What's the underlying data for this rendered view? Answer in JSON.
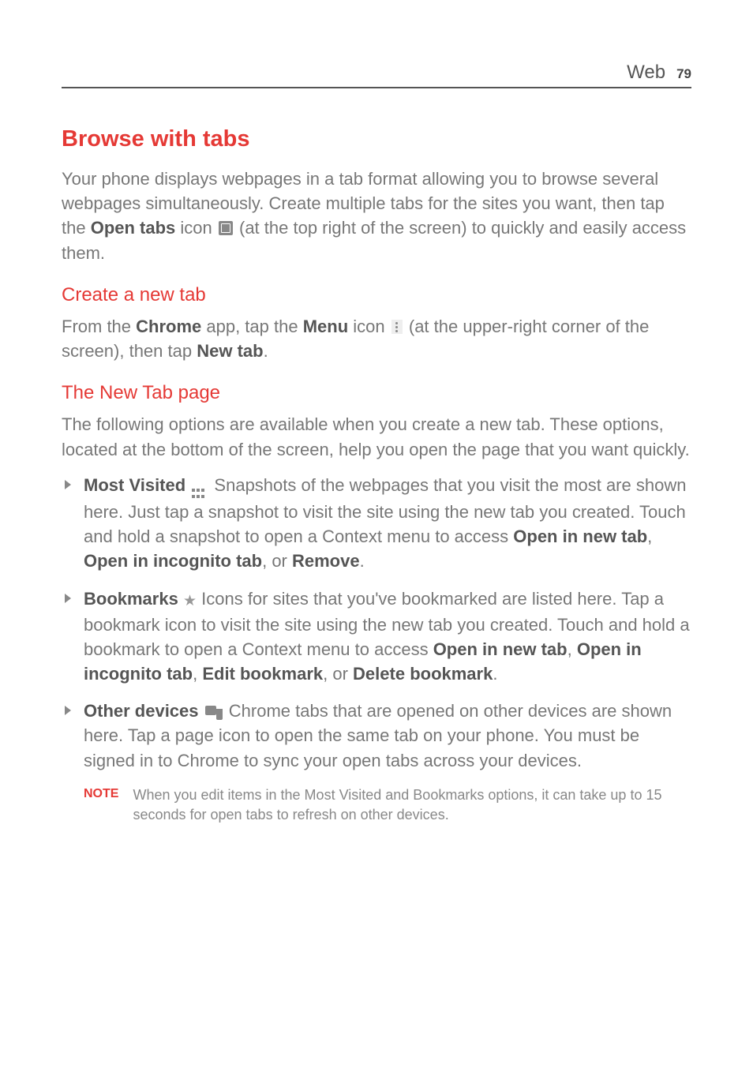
{
  "header": {
    "section": "Web",
    "page": "79"
  },
  "h1": "Browse with tabs",
  "intro": {
    "pre": "Your phone displays webpages in a tab format allowing you to browse several webpages simultaneously. Create multiple tabs for the sites you want, then tap the ",
    "bold1": "Open tabs",
    "mid": " icon ",
    "post": " (at the top right of the screen) to quickly and easily access them."
  },
  "sec1": {
    "title": "Create a new tab",
    "pre": "From the ",
    "b1": "Chrome",
    "mid1": " app, tap the ",
    "b2": "Menu",
    "mid2": " icon ",
    "post1": " (at the upper-right corner of the screen), then tap ",
    "b3": "New tab",
    "post2": "."
  },
  "sec2": {
    "title": "The New Tab page",
    "intro": "The following options are available when you create a new tab. These options, located at the bottom of the screen, help you open the page that you want quickly."
  },
  "bullets": {
    "b1": {
      "title": "Most Visited",
      "text1": " Snapshots of the webpages that you visit the most are shown here. Just tap a snapshot to visit the site using the new tab you created. Touch and hold a snapshot to open a Context menu to access ",
      "o1": "Open in new tab",
      "c1": ", ",
      "o2": "Open in incognito tab",
      "c2": ", or ",
      "o3": "Remove",
      "c3": "."
    },
    "b2": {
      "title": "Bookmarks",
      "text1": " Icons for sites that you've bookmarked are listed here. Tap a bookmark icon to visit the site using the new tab you created. Touch and hold a bookmark to open a Context menu to access ",
      "o1": "Open in new tab",
      "c1": ", ",
      "o2": "Open in incognito tab",
      "c2": ", ",
      "o3": "Edit bookmark",
      "c3": ", or ",
      "o4": "Delete bookmark",
      "c4": "."
    },
    "b3": {
      "title": "Other devices",
      "text1": " Chrome tabs that are opened on other devices are shown here. Tap a page icon to open the same tab on your phone. You must be signed in to Chrome to sync your open tabs across your devices."
    }
  },
  "note": {
    "label": "NOTE",
    "text": "When you edit items in the Most Visited and Bookmarks options, it can take up to 15 seconds for open tabs to refresh on other devices."
  }
}
